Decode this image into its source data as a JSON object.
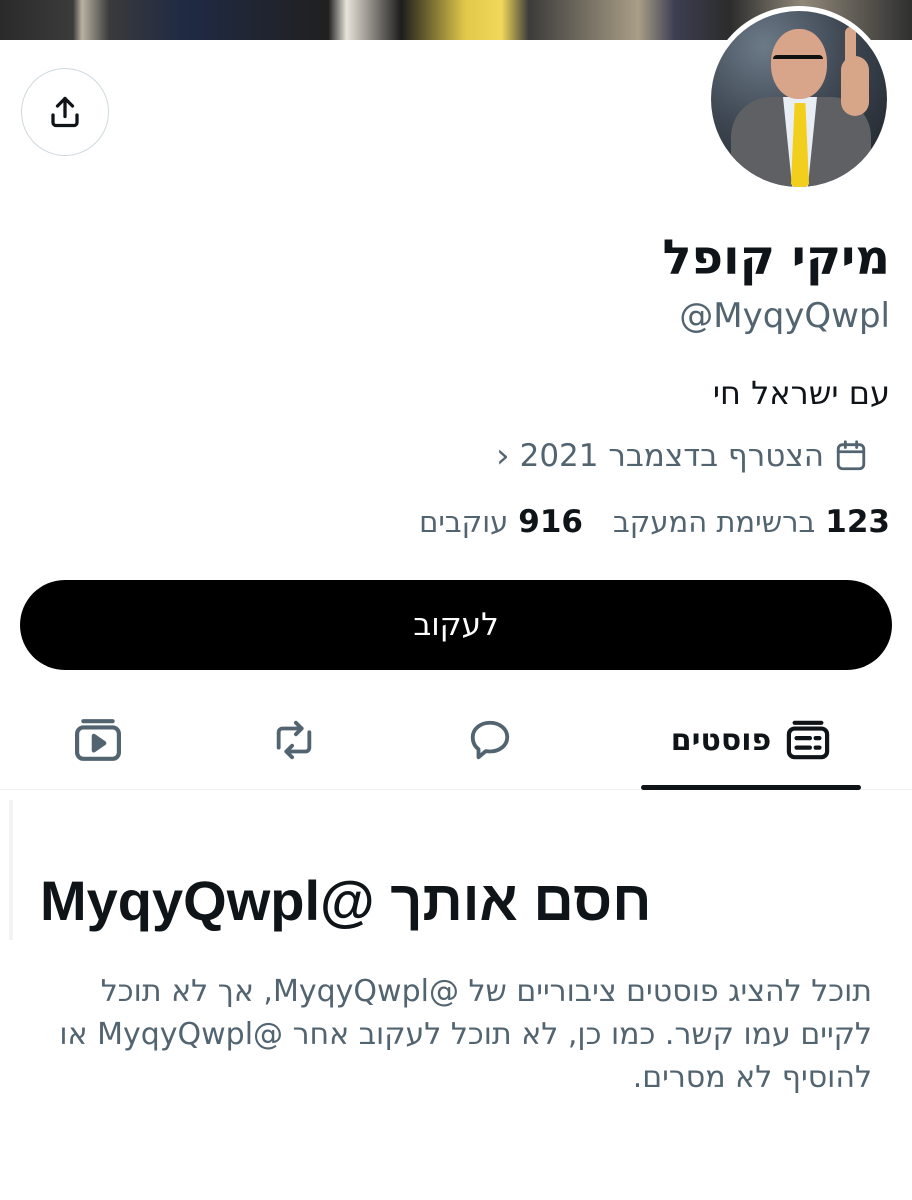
{
  "profile": {
    "name": "מיקי קופל",
    "handle": "@MyqyQwpl",
    "bio": "עם ישראל חי",
    "joined": "הצטרף בדצמבר 2021",
    "following_count": "123",
    "following_label": "ברשימת המעקב",
    "followers_count": "916",
    "followers_label": "עוקבים"
  },
  "actions": {
    "follow_label": "לעקוב"
  },
  "tabs": {
    "posts_label": "פוסטים"
  },
  "blocked": {
    "title": "חסם אותך @MyqyQwpl",
    "body": "תוכל להציג פוסטים ציבוריים של @MyqyQwpl, אך לא תוכל לקיים עמו קשר. כמו כן, לא תוכל לעקוב אחר @MyqyQwpl או להוסיף לא מסרים."
  },
  "icons": {
    "share": "share-icon",
    "calendar": "calendar-icon",
    "chevron": "chevron-left-icon",
    "posts": "posts-icon",
    "replies": "reply-bubble-icon",
    "reposts": "repost-icon",
    "media": "media-icon"
  }
}
